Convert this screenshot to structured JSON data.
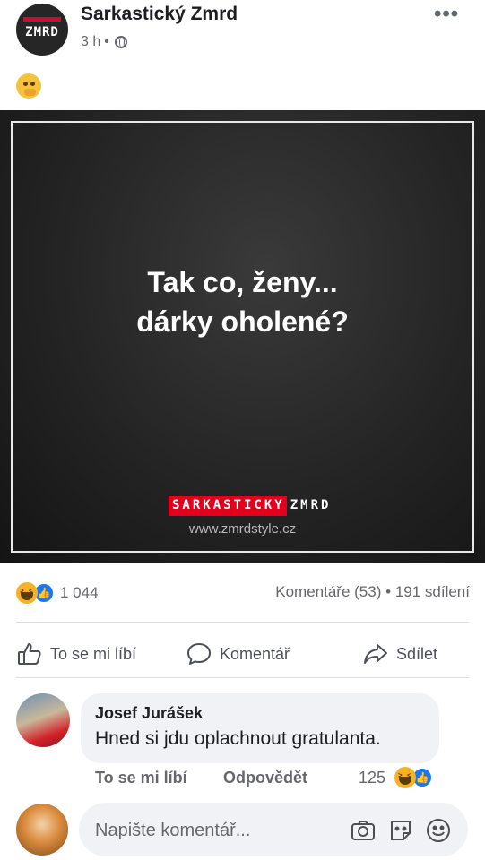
{
  "post": {
    "page_name": "Sarkastický Zmrd",
    "avatar_text": "ZMRD",
    "time": "3 h",
    "separator": "•",
    "more_label": "•••",
    "emoji": "🤔"
  },
  "image": {
    "line1": "Tak co, ženy...",
    "line2": "dárky oholené?",
    "brand_red": "SARKASTICKY",
    "brand_white": "ZMRD",
    "url": "www.zmrdstyle.cz"
  },
  "stats": {
    "reaction_count": "1 044",
    "comments": "Komentáře (53)",
    "dot": "•",
    "shares": "191 sdílení"
  },
  "actions": {
    "like": "To se mi líbí",
    "comment": "Komentář",
    "share": "Sdílet"
  },
  "comment": {
    "author": "Josef Jurášek",
    "text": "Hned si jdu oplachnout gratulanta.",
    "like": "To se mi líbí",
    "reply": "Odpovědět",
    "count": "125"
  },
  "composer": {
    "placeholder": "Napište komentář..."
  },
  "colors": {
    "accent": "#1877f2",
    "brand_red": "#e3001b",
    "text_secondary": "#65676b"
  }
}
